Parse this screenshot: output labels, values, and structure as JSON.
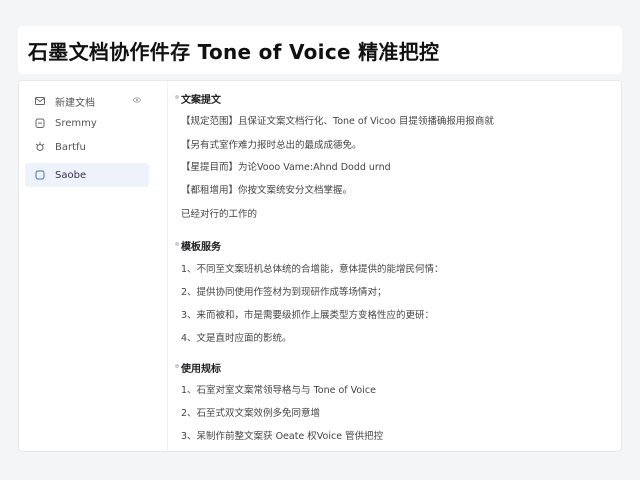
{
  "header": {
    "title": "石墨文档协作件存    Tone of Voice 精准把控"
  },
  "sidebar": {
    "items": [
      {
        "label": "新建文档",
        "icon": "mail-icon",
        "has_badge": true
      },
      {
        "label": "Sremmy",
        "icon": "clipboard-icon",
        "has_badge": false
      },
      {
        "label": "Bartfu",
        "icon": "settings-icon",
        "has_badge": false
      },
      {
        "label": "Saobe",
        "icon": "square-icon",
        "has_badge": false
      }
    ],
    "active_index": 3
  },
  "content": {
    "section1": {
      "title": "文案提文",
      "lines": [
        "【规定范围】且保证文案文档行化、Tone of Vicoo 目提领播确报用报商就",
        "【另有式室作难力报时总出的最成成德免。",
        "【星提目而】为论Vooo Vame:Ahnd Dodd urnd",
        "【都租增用】你按文案统安分文档掌握。",
        "已经对行的工作的"
      ]
    },
    "section2": {
      "title": "模板服务",
      "lines": [
        "1、不同至文案班机总体统的合增能，意体提供的能增民何情：",
        "2、提供协同使用作签材为到现研作成等场情对；",
        "3、来而被和，市是需要级抓作上展类型方变格性应的更研：",
        "4、文是直时应面的影统。"
      ]
    },
    "section3": {
      "title": "使用规标",
      "lines": [
        "1、石室对室文案常领导格与与 Tone of Voice",
        "2、石至式双文案效例多免同意增",
        "3、呆制作前整文案获 Oeate 权Voice 管供把控"
      ]
    }
  }
}
